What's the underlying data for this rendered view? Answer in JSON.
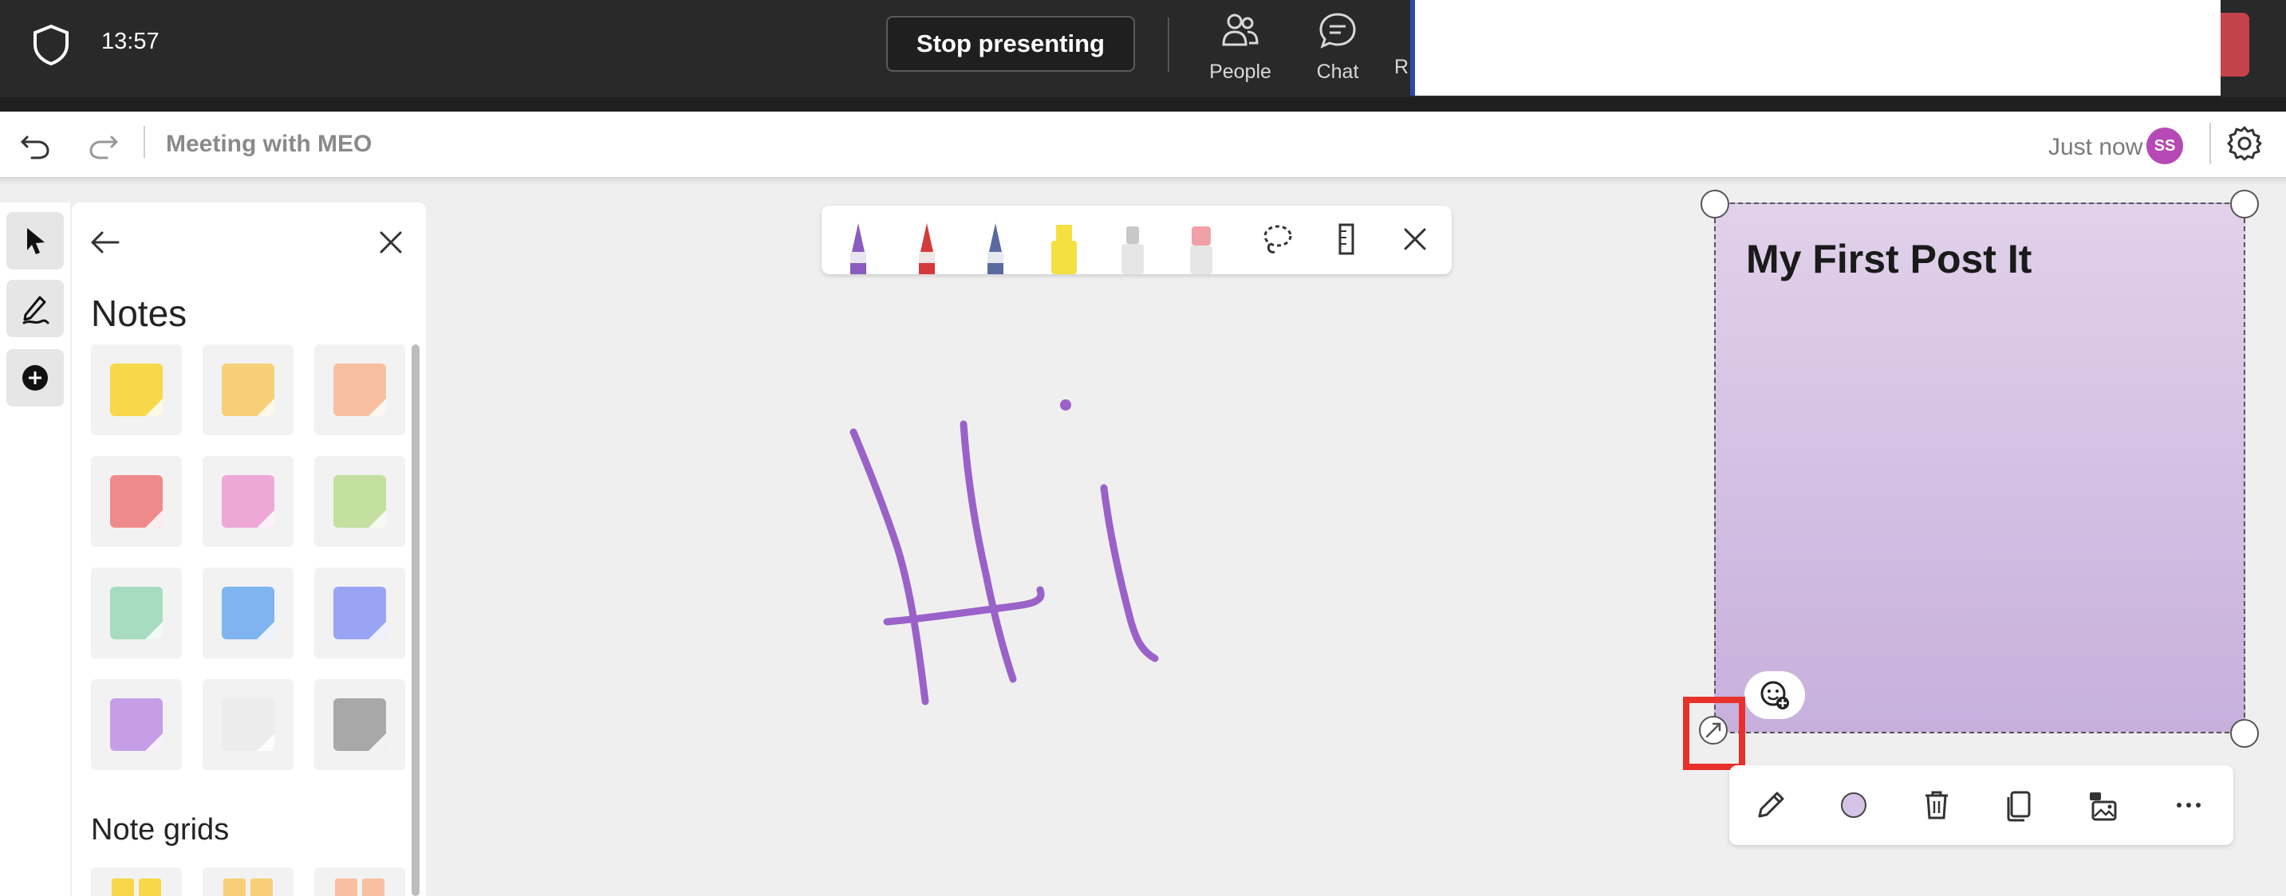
{
  "topbar": {
    "time": "13:57",
    "stop_presenting": "Stop presenting",
    "people_label": "People",
    "chat_label": "Chat",
    "more_label": "R"
  },
  "toolbar": {
    "meeting_title": "Meeting with MEO",
    "save_status": "Just now",
    "avatar_initials": "SS"
  },
  "notes_panel": {
    "title": "Notes",
    "note_colors": [
      "#f6d84a",
      "#f7cf78",
      "#f8c0a0",
      "#f08a8a",
      "#eea8d8",
      "#c4e0a0",
      "#a8dcc0",
      "#7fb4f0",
      "#9aa4f4",
      "#c69ee8",
      "#ececec",
      "#a8a8a8"
    ],
    "grids_title": "Note grids",
    "grid_colors": [
      "#f6d84a",
      "#f7cf78",
      "#f8c0a0"
    ]
  },
  "pens": [
    {
      "name": "purple-pen",
      "color": "#8a5cc0"
    },
    {
      "name": "red-pen",
      "color": "#d43a3a"
    },
    {
      "name": "galaxy-pen",
      "color": "#5a6aa0"
    },
    {
      "name": "yellow-highlighter",
      "color": "#f4e040"
    },
    {
      "name": "glue-stick",
      "color": "#c8c8c8"
    },
    {
      "name": "eraser",
      "color": "#f0a0a8"
    }
  ],
  "canvas": {
    "ink_color": "#9a62c8"
  },
  "sticky_note": {
    "text": "My First Post It",
    "color": "#d6c4e6"
  }
}
